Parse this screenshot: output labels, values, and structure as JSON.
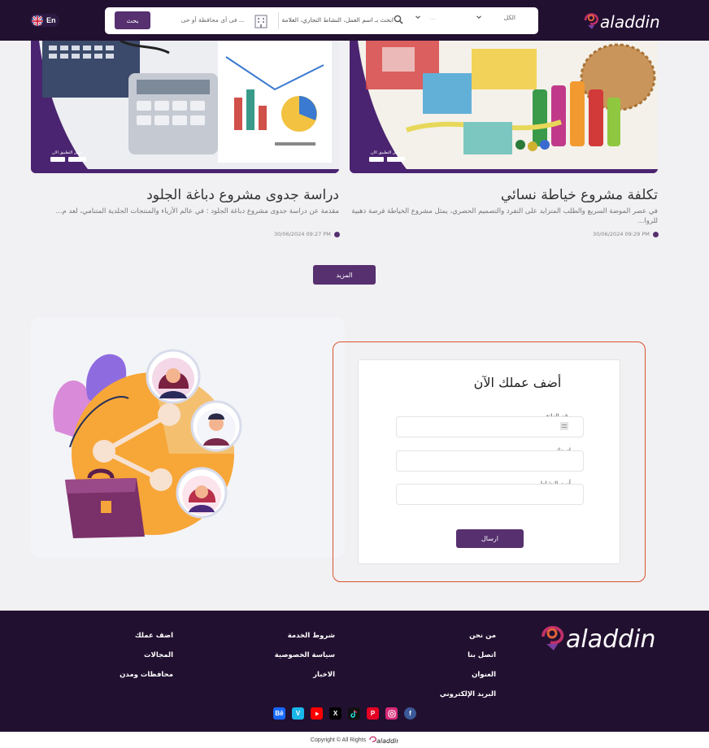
{
  "header": {
    "lang": "En",
    "search_button": "بحث",
    "location_placeholder": "... فى أى محافظة أو حى",
    "query_placeholder": "ابحث بـ اسم العمل، النشاط التجاري، العلامة",
    "select_secondary": "...",
    "select_primary": "الكل",
    "logo_text": "aladdin"
  },
  "articles": [
    {
      "title": "تكلفة مشروع خياطة نسائي",
      "description": "في عصر الموضة السريع والطلب المتزايد على التفرد والتصميم الحصري، يمثل مشروع الخياطة فرصة ذهبية للروا...",
      "date": "30/06/2024 09:29 PM",
      "image_badge": "حمل التطبيق الان"
    },
    {
      "title": "دراسة جدوى مشروع دباغة الجلود",
      "description": "مقدمة عن دراسة جدوى مشروع دباغة الجلود :  في عالم الأزياء والمنتجات الجلدية المتنامي، لعد م...",
      "date": "30/06/2024 09:27 PM",
      "image_badge": "حمل التطبيق الان"
    }
  ],
  "more_button": "المزيد",
  "add_business": {
    "title": "أضف عملك الآن",
    "phone_label": "رقم الهاتف",
    "name_label": "اسمك",
    "activity_label": "أسم النشاط",
    "submit": "ارسال"
  },
  "footer": {
    "col1": [
      "من نحن",
      "اتصل بنا",
      "العنوان",
      "البريد الإلكتروني"
    ],
    "col2": [
      "شروط الخدمة",
      "سياسة الخصوصية",
      "الاخبار"
    ],
    "col3": [
      "اضف عملك",
      "المجالات",
      "محافظات ومدن"
    ],
    "copyright": "Copyright © All Rights",
    "logo_text": "aladdin"
  },
  "colors": {
    "brand_dark": "#221030",
    "brand_purple": "#56306f",
    "accent_orange": "#d9542c"
  }
}
